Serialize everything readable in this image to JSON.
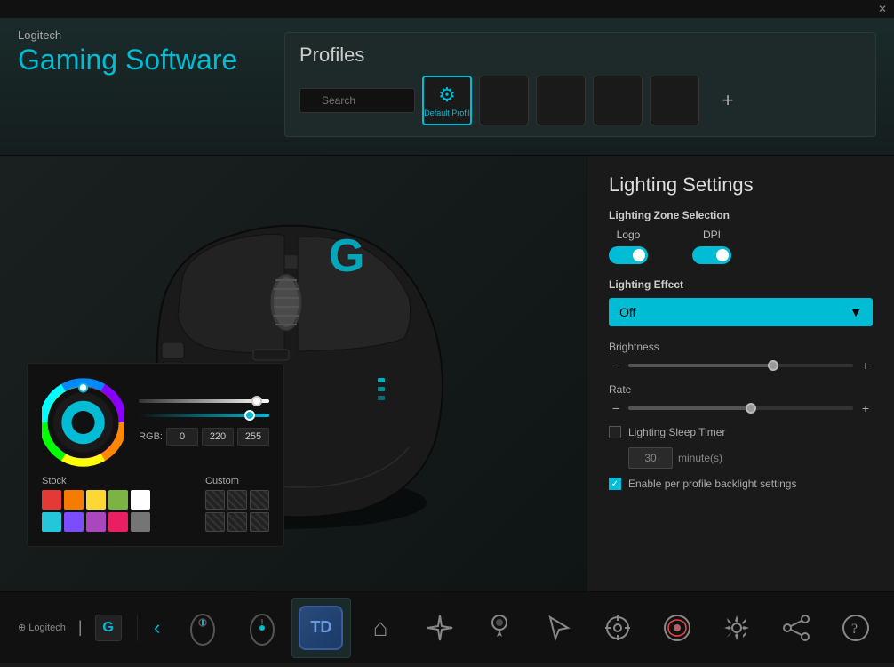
{
  "titlebar": {
    "close_label": "✕"
  },
  "header": {
    "brand": "Logitech",
    "title_line1": "Gaming Software"
  },
  "profiles": {
    "title": "Profiles",
    "search_placeholder": "Search",
    "default_profile_label": "Default Profil",
    "add_button": "+",
    "slots": [
      {
        "type": "active",
        "label": "Default Profil"
      },
      {
        "type": "empty"
      },
      {
        "type": "empty"
      },
      {
        "type": "empty"
      },
      {
        "type": "empty"
      }
    ]
  },
  "lighting": {
    "title": "Lighting Settings",
    "zone_label": "Lighting Zone Selection",
    "zone_logo": "Logo",
    "zone_dpi": "DPI",
    "effect_label": "Lighting Effect",
    "effect_value": "Off",
    "brightness_label": "Brightness",
    "rate_label": "Rate",
    "sleep_timer_label": "Lighting Sleep Timer",
    "sleep_value": "30",
    "sleep_unit": "minute(s)",
    "backlight_label": "Enable per profile backlight settings",
    "minus": "−",
    "plus": "+"
  },
  "color_picker": {
    "rgb_label": "RGB:",
    "r_value": "0",
    "g_value": "220",
    "b_value": "255",
    "stock_label": "Stock",
    "custom_label": "Custom",
    "swatches": [
      "#e53935",
      "#f57c00",
      "#fdd835",
      "#7cb342",
      "#ffffff",
      "#26c6da",
      "#7c4dff",
      "#ab47bc",
      "#e91e63",
      "#757575"
    ]
  },
  "bottom_bar": {
    "brand": "⊕ Logitech",
    "g_label": "G",
    "nav_items": [
      {
        "icon": "🖱",
        "label": "mouse",
        "active": false
      },
      {
        "icon": "↑",
        "label": "dpi",
        "active": false
      },
      {
        "icon": "TD",
        "label": "profile-badge",
        "active": true
      },
      {
        "icon": "⌂",
        "label": "home",
        "active": false
      },
      {
        "icon": "✦",
        "label": "effects",
        "active": false
      },
      {
        "icon": "💡",
        "label": "lighting",
        "active": false
      },
      {
        "icon": "✂",
        "label": "cut",
        "active": false
      },
      {
        "icon": "⊕",
        "label": "target",
        "active": false
      },
      {
        "icon": "🎮",
        "label": "game",
        "active": false
      },
      {
        "icon": "⚙",
        "label": "settings",
        "active": false
      },
      {
        "icon": "↗",
        "label": "share",
        "active": false
      },
      {
        "icon": "?",
        "label": "help",
        "active": false
      }
    ]
  }
}
